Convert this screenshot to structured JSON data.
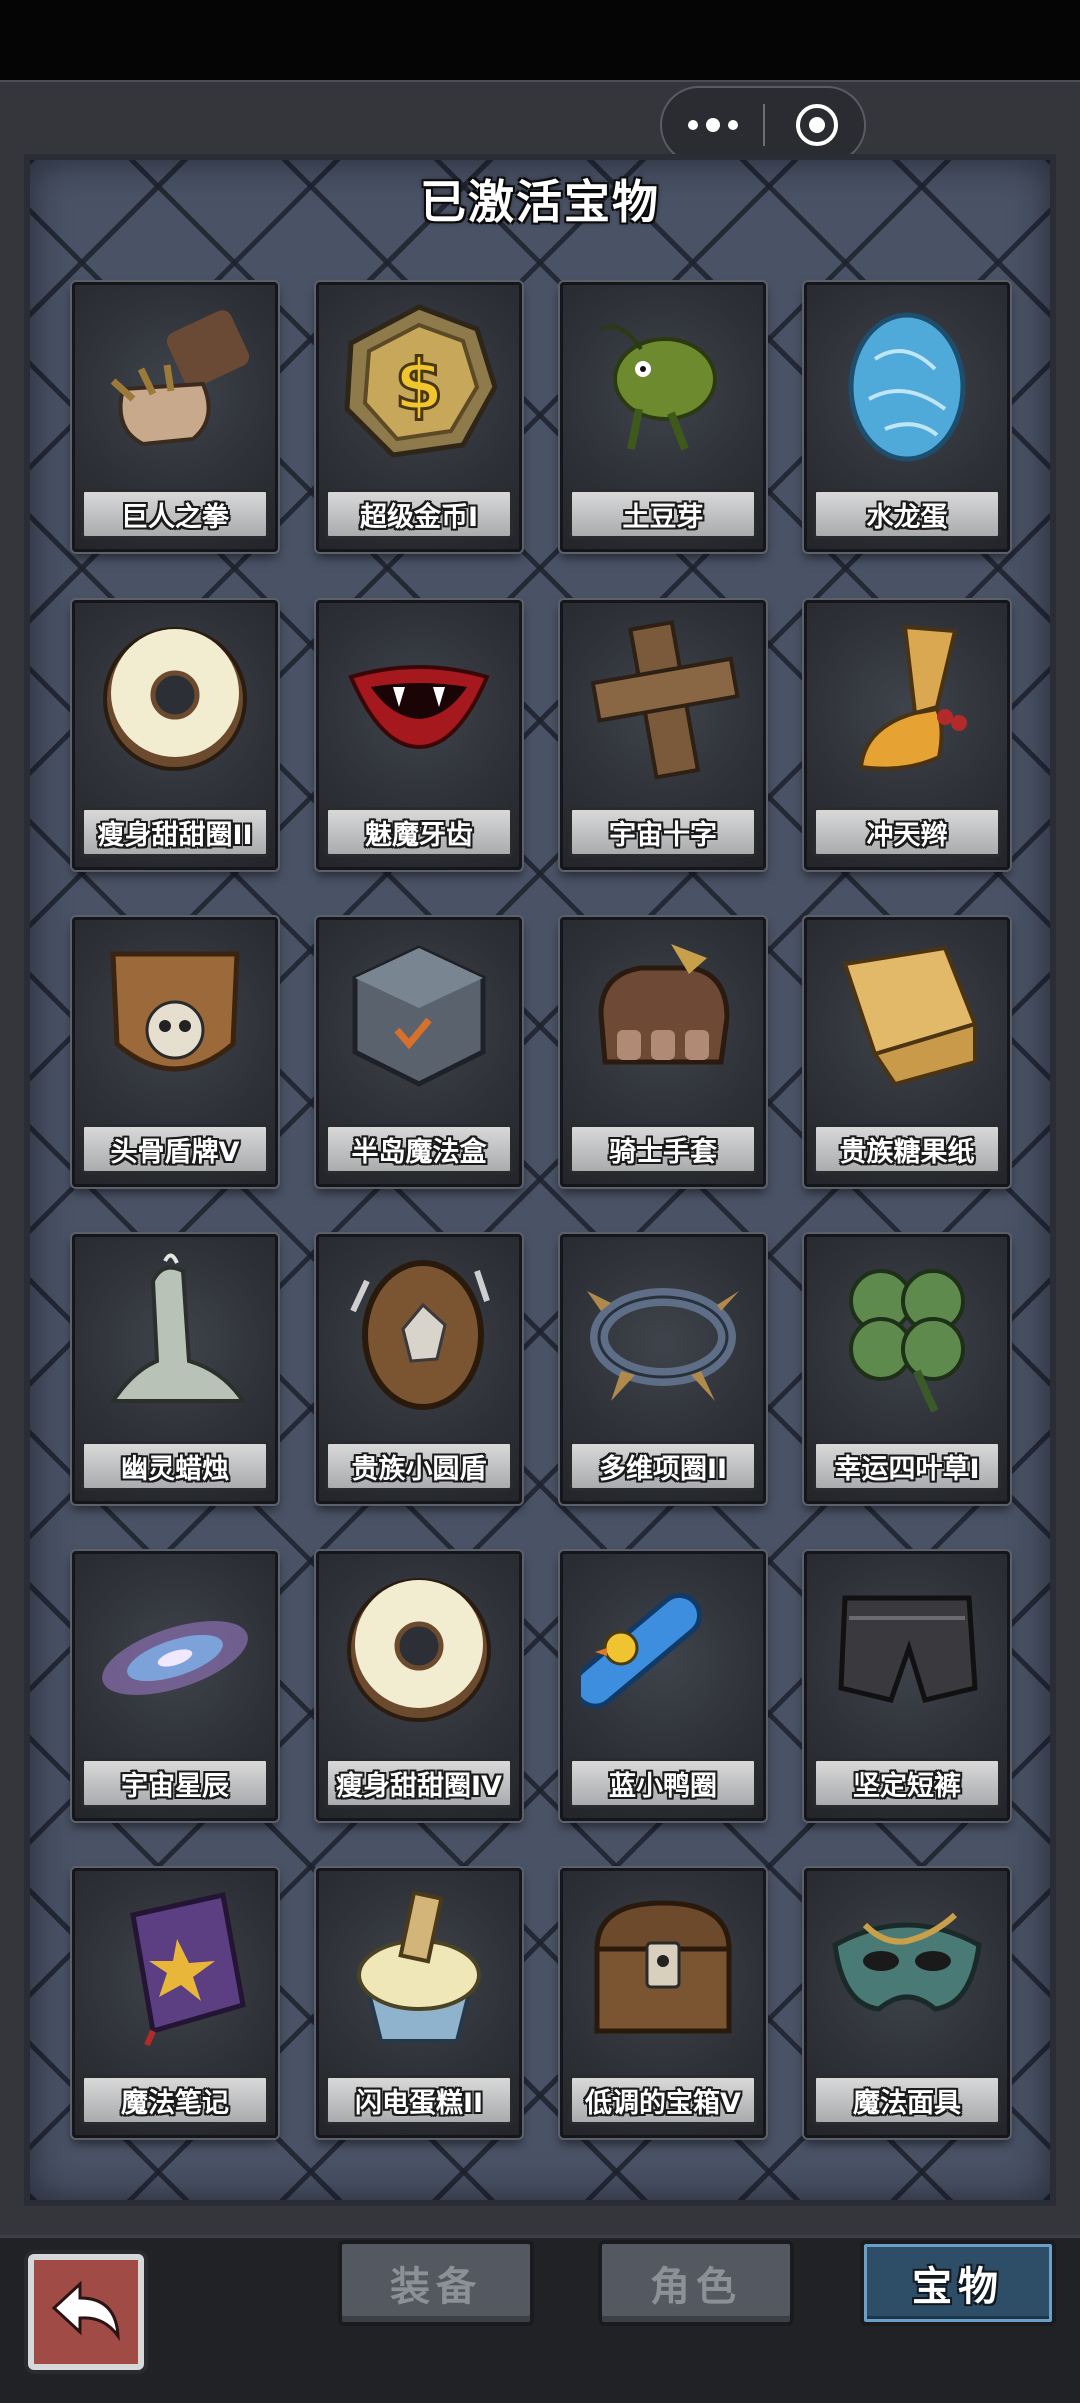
{
  "panel": {
    "title": "已激活宝物"
  },
  "treasures": [
    {
      "name": "巨人之拳",
      "icon": "giant-fist-icon"
    },
    {
      "name": "超级金币I",
      "icon": "gold-coin-icon"
    },
    {
      "name": "土豆芽",
      "icon": "potato-sprout-icon"
    },
    {
      "name": "水龙蛋",
      "icon": "water-dragon-egg-icon"
    },
    {
      "name": "瘦身甜甜圈II",
      "icon": "donut-icon"
    },
    {
      "name": "魅魔牙齿",
      "icon": "fang-lips-icon"
    },
    {
      "name": "宇宙十字",
      "icon": "wooden-cross-icon"
    },
    {
      "name": "冲天辫",
      "icon": "pigtail-icon"
    },
    {
      "name": "头骨盾牌V",
      "icon": "skull-shield-icon"
    },
    {
      "name": "半岛魔法盒",
      "icon": "magic-cube-icon"
    },
    {
      "name": "骑士手套",
      "icon": "knight-gauntlet-icon"
    },
    {
      "name": "贵族糖果纸",
      "icon": "candy-wrapper-icon"
    },
    {
      "name": "幽灵蜡烛",
      "icon": "ghost-candle-icon"
    },
    {
      "name": "贵族小圆盾",
      "icon": "round-shield-icon"
    },
    {
      "name": "多维项圈II",
      "icon": "spiked-collar-icon"
    },
    {
      "name": "幸运四叶草I",
      "icon": "four-leaf-clover-icon"
    },
    {
      "name": "宇宙星辰",
      "icon": "galaxy-icon"
    },
    {
      "name": "瘦身甜甜圈IV",
      "icon": "donut-icon"
    },
    {
      "name": "蓝小鸭圈",
      "icon": "duck-float-ring-icon"
    },
    {
      "name": "坚定短裤",
      "icon": "leather-shorts-icon"
    },
    {
      "name": "魔法笔记",
      "icon": "spell-book-icon"
    },
    {
      "name": "闪电蛋糕II",
      "icon": "cupcake-icon"
    },
    {
      "name": "低调的宝箱V",
      "icon": "treasure-chest-icon"
    },
    {
      "name": "魔法面具",
      "icon": "masquerade-mask-icon"
    }
  ],
  "tabs": [
    {
      "label": "装备",
      "active": false
    },
    {
      "label": "角色",
      "active": false
    },
    {
      "label": "宝物",
      "active": true
    }
  ],
  "colors": {
    "panel": "#4a5366",
    "active_tab": "#2e4d66",
    "back_button": "#a04b46"
  }
}
